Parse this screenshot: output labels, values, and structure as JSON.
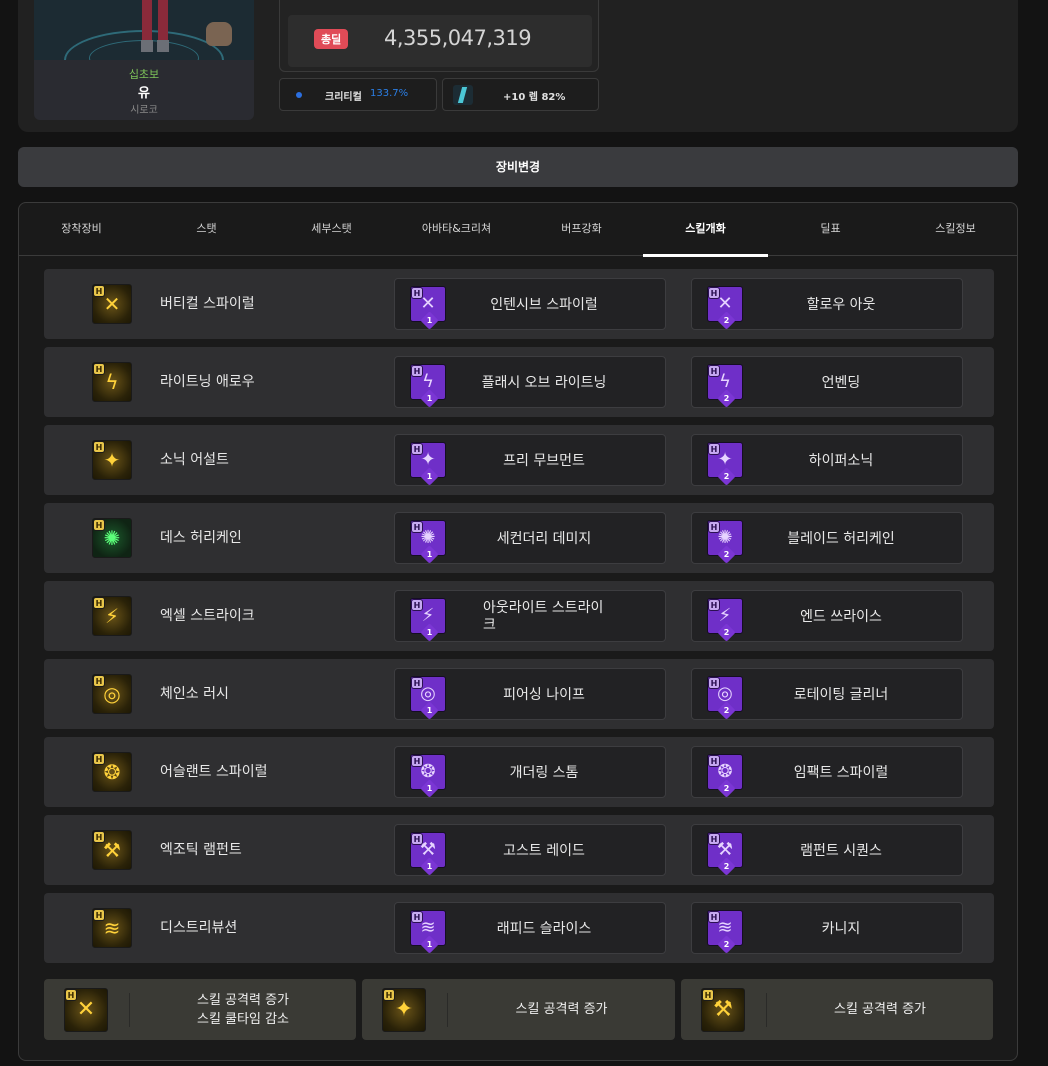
{
  "character": {
    "level_label": "십초보",
    "name": "유",
    "guild": "시로코"
  },
  "damage": {
    "badge": "총딜",
    "value": "4,355,047,319"
  },
  "stats": {
    "crit_label": "크리티컬",
    "crit_value": "133.7%",
    "level_text": "+10 렙 82%"
  },
  "change_button": "장비변경",
  "tabs": [
    {
      "label": "장착장비",
      "active": false
    },
    {
      "label": "스탯",
      "active": false
    },
    {
      "label": "세부스탯",
      "active": false
    },
    {
      "label": "아바타&크리쳐",
      "active": false
    },
    {
      "label": "버프강화",
      "active": false
    },
    {
      "label": "스킬개화",
      "active": true
    },
    {
      "label": "딜표",
      "active": false
    },
    {
      "label": "스킬정보",
      "active": false
    }
  ],
  "skills": [
    {
      "base": "버티컬 스파이럴",
      "icon": "crossbow-icon",
      "glyph": "✕",
      "enh1": "인텐시브 스파이럴",
      "enh2": "할로우 아웃"
    },
    {
      "base": "라이트닝 애로우",
      "icon": "lightning-icon",
      "glyph": "ϟ",
      "enh1": "플래시 오브 라이트닝",
      "enh2": "언벤딩"
    },
    {
      "base": "소닉 어설트",
      "icon": "sparkle-icon",
      "glyph": "✦",
      "enh1": "프리 무브먼트",
      "enh2": "하이퍼소닉"
    },
    {
      "base": "데스 허리케인",
      "icon": "hurricane-icon",
      "glyph": "✺",
      "enh1": "세컨더리 데미지",
      "enh2": "블레이드 허리케인"
    },
    {
      "base": "엑셀 스트라이크",
      "icon": "strike-icon",
      "glyph": "⚡",
      "enh1": "아웃라이트 스트라이크",
      "enh2": "엔드 쓰라이스"
    },
    {
      "base": "체인소 러시",
      "icon": "chainsaw-icon",
      "glyph": "◎",
      "enh1": "피어싱 나이프",
      "enh2": "로테이팅 글리너"
    },
    {
      "base": "어슬랜트 스파이럴",
      "icon": "spiral-icon",
      "glyph": "❂",
      "enh1": "개더링 스톰",
      "enh2": "임팩트 스파이럴"
    },
    {
      "base": "엑조틱 램펀트",
      "icon": "scythe-icon",
      "glyph": "⚒",
      "enh1": "고스트 레이드",
      "enh2": "램펀트 시퀀스"
    },
    {
      "base": "디스트리뷰션",
      "icon": "distribution-icon",
      "glyph": "≋",
      "enh1": "래피드 슬라이스",
      "enh2": "카니지"
    }
  ],
  "enh_levels": {
    "first": "1",
    "second": "2"
  },
  "h_badge": "H",
  "summary": [
    {
      "line1": "스킬 공격력 증가",
      "line2": "스킬 쿨타임 감소",
      "icon": "crossbow-icon",
      "glyph": "✕"
    },
    {
      "line1": "스킬 공격력 증가",
      "line2": "",
      "icon": "sparkle-icon",
      "glyph": "✦"
    },
    {
      "line1": "스킬 공격력 증가",
      "line2": "",
      "icon": "scythe-icon",
      "glyph": "⚒"
    }
  ],
  "colors": {
    "accent_red": "#e04b57",
    "crit_blue": "#2b7fe6",
    "enhance_purple": "#6f2fc8",
    "hyper_gold": "#e8c64a"
  }
}
